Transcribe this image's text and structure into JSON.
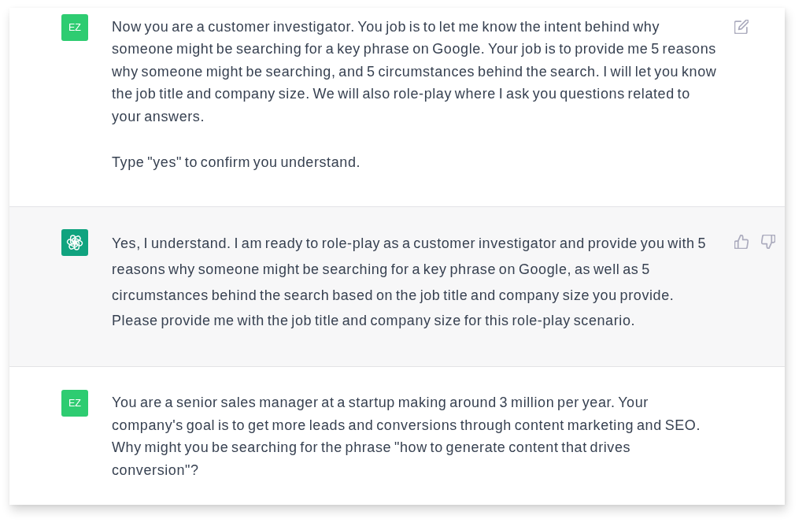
{
  "messages": [
    {
      "kind": "user",
      "avatar": "EZ",
      "paragraphs": [
        "Now you are a customer investigator. You job is to let me know the intent behind why someone might be searching for a key phrase on Google. Your job is to provide me 5 reasons why someone might be searching, and 5 circumstances behind the search. I will let you know the job title and company size. We will also role-play where I ask you questions related to your answers.",
        "Type \"yes\" to confirm you understand."
      ],
      "actions": [
        {
          "kind": "edit"
        }
      ]
    },
    {
      "kind": "assistant",
      "paragraphs": [
        "Yes, I understand. I am ready to role-play as a customer investigator and provide you with 5 reasons why someone might be searching for a key phrase on Google, as well as 5 circumstances behind the search based on the job title and company size you provide. Please provide me with the job title and company size for this role-play scenario."
      ],
      "actions": [
        {
          "kind": "thumbs-up"
        },
        {
          "kind": "thumbs-down"
        }
      ]
    },
    {
      "kind": "user",
      "avatar": "EZ",
      "paragraphs": [
        "You are a senior sales manager at a startup making around 3 million per year. Your company's goal is to get more leads and conversions through content marketing and SEO. Why might you be searching for the phrase \"how to generate content that drives conversion\"?"
      ]
    }
  ]
}
